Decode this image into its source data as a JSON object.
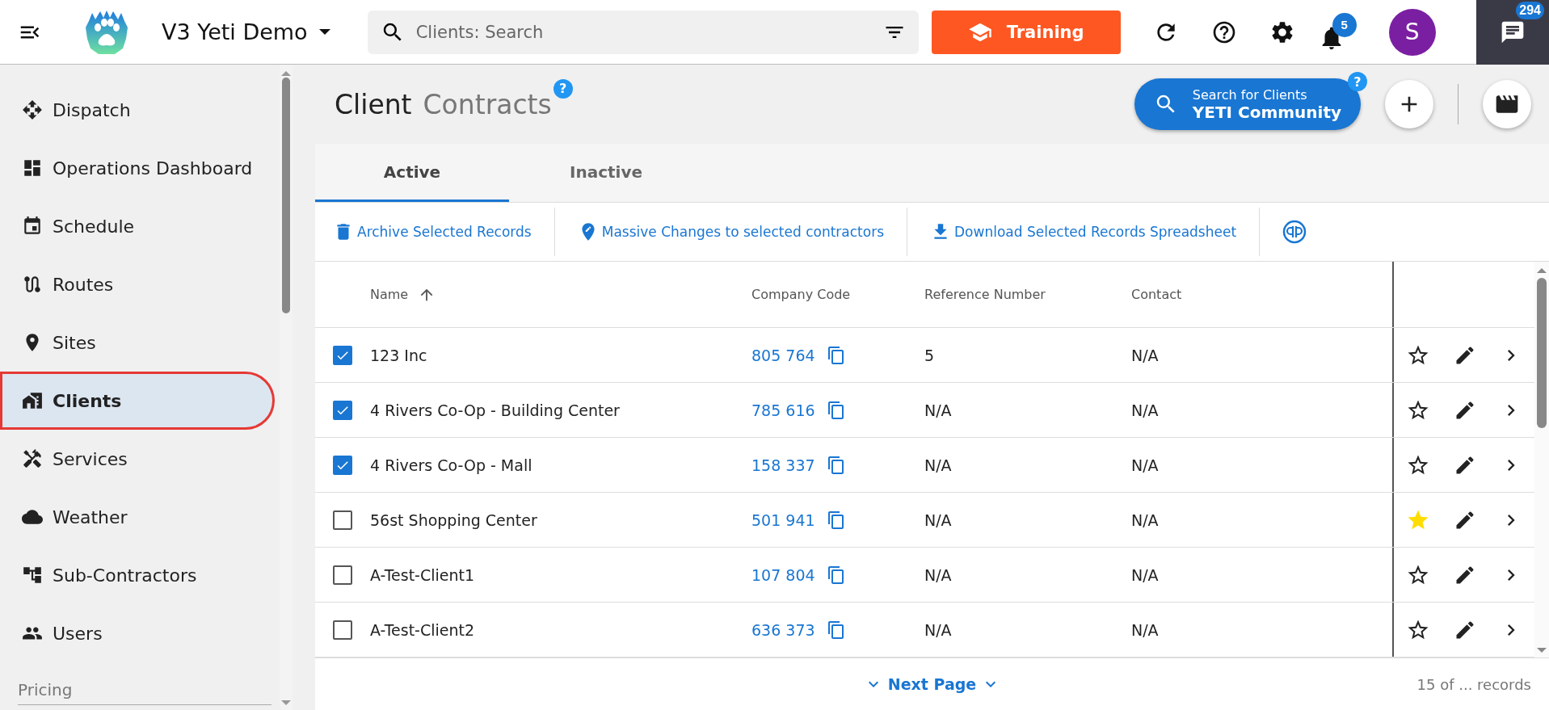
{
  "topbar": {
    "company": "V3 Yeti Demo",
    "search": {
      "placeholder": "Clients: Search"
    },
    "training": "Training",
    "notifications": "5",
    "avatar": "S",
    "messages": "294"
  },
  "sidebar": {
    "items": [
      {
        "label": "Dispatch",
        "selected": false
      },
      {
        "label": "Operations Dashboard",
        "selected": false
      },
      {
        "label": "Schedule",
        "selected": false
      },
      {
        "label": "Routes",
        "selected": false
      },
      {
        "label": "Sites",
        "selected": false
      },
      {
        "label": "Clients",
        "selected": true
      },
      {
        "label": "Services",
        "selected": false
      },
      {
        "label": "Weather",
        "selected": false
      },
      {
        "label": "Sub-Contractors",
        "selected": false
      },
      {
        "label": "Users",
        "selected": false
      }
    ],
    "section": "Pricing"
  },
  "page": {
    "title": "Client",
    "subtitle": "Contracts",
    "help": "?",
    "community": {
      "line1": "Search for Clients",
      "line2": "YETI Community",
      "help": "?"
    }
  },
  "tabs": [
    {
      "label": "Active",
      "selected": true
    },
    {
      "label": "Inactive",
      "selected": false
    }
  ],
  "actions": [
    "Archive Selected Records",
    "Massive Changes to selected contractors",
    "Download Selected Records Spreadsheet"
  ],
  "table": {
    "columns": [
      "Name",
      "Company Code",
      "Reference Number",
      "Contact"
    ],
    "rows": [
      {
        "checked": true,
        "name": "123 Inc",
        "code": "805 764",
        "reference": "5",
        "contact": "N/A",
        "favorite": false
      },
      {
        "checked": true,
        "name": "4 Rivers Co-Op - Building Center",
        "code": "785 616",
        "reference": "N/A",
        "contact": "N/A",
        "favorite": false
      },
      {
        "checked": true,
        "name": "4 Rivers Co-Op - Mall",
        "code": "158 337",
        "reference": "N/A",
        "contact": "N/A",
        "favorite": false
      },
      {
        "checked": false,
        "name": "56st Shopping Center",
        "code": "501 941",
        "reference": "N/A",
        "contact": "N/A",
        "favorite": true
      },
      {
        "checked": false,
        "name": "A-Test-Client1",
        "code": "107 804",
        "reference": "N/A",
        "contact": "N/A",
        "favorite": false
      },
      {
        "checked": false,
        "name": "A-Test-Client2",
        "code": "636 373",
        "reference": "N/A",
        "contact": "N/A",
        "favorite": false
      }
    ]
  },
  "footer": {
    "next": "Next Page",
    "count": "15 of ... records"
  }
}
